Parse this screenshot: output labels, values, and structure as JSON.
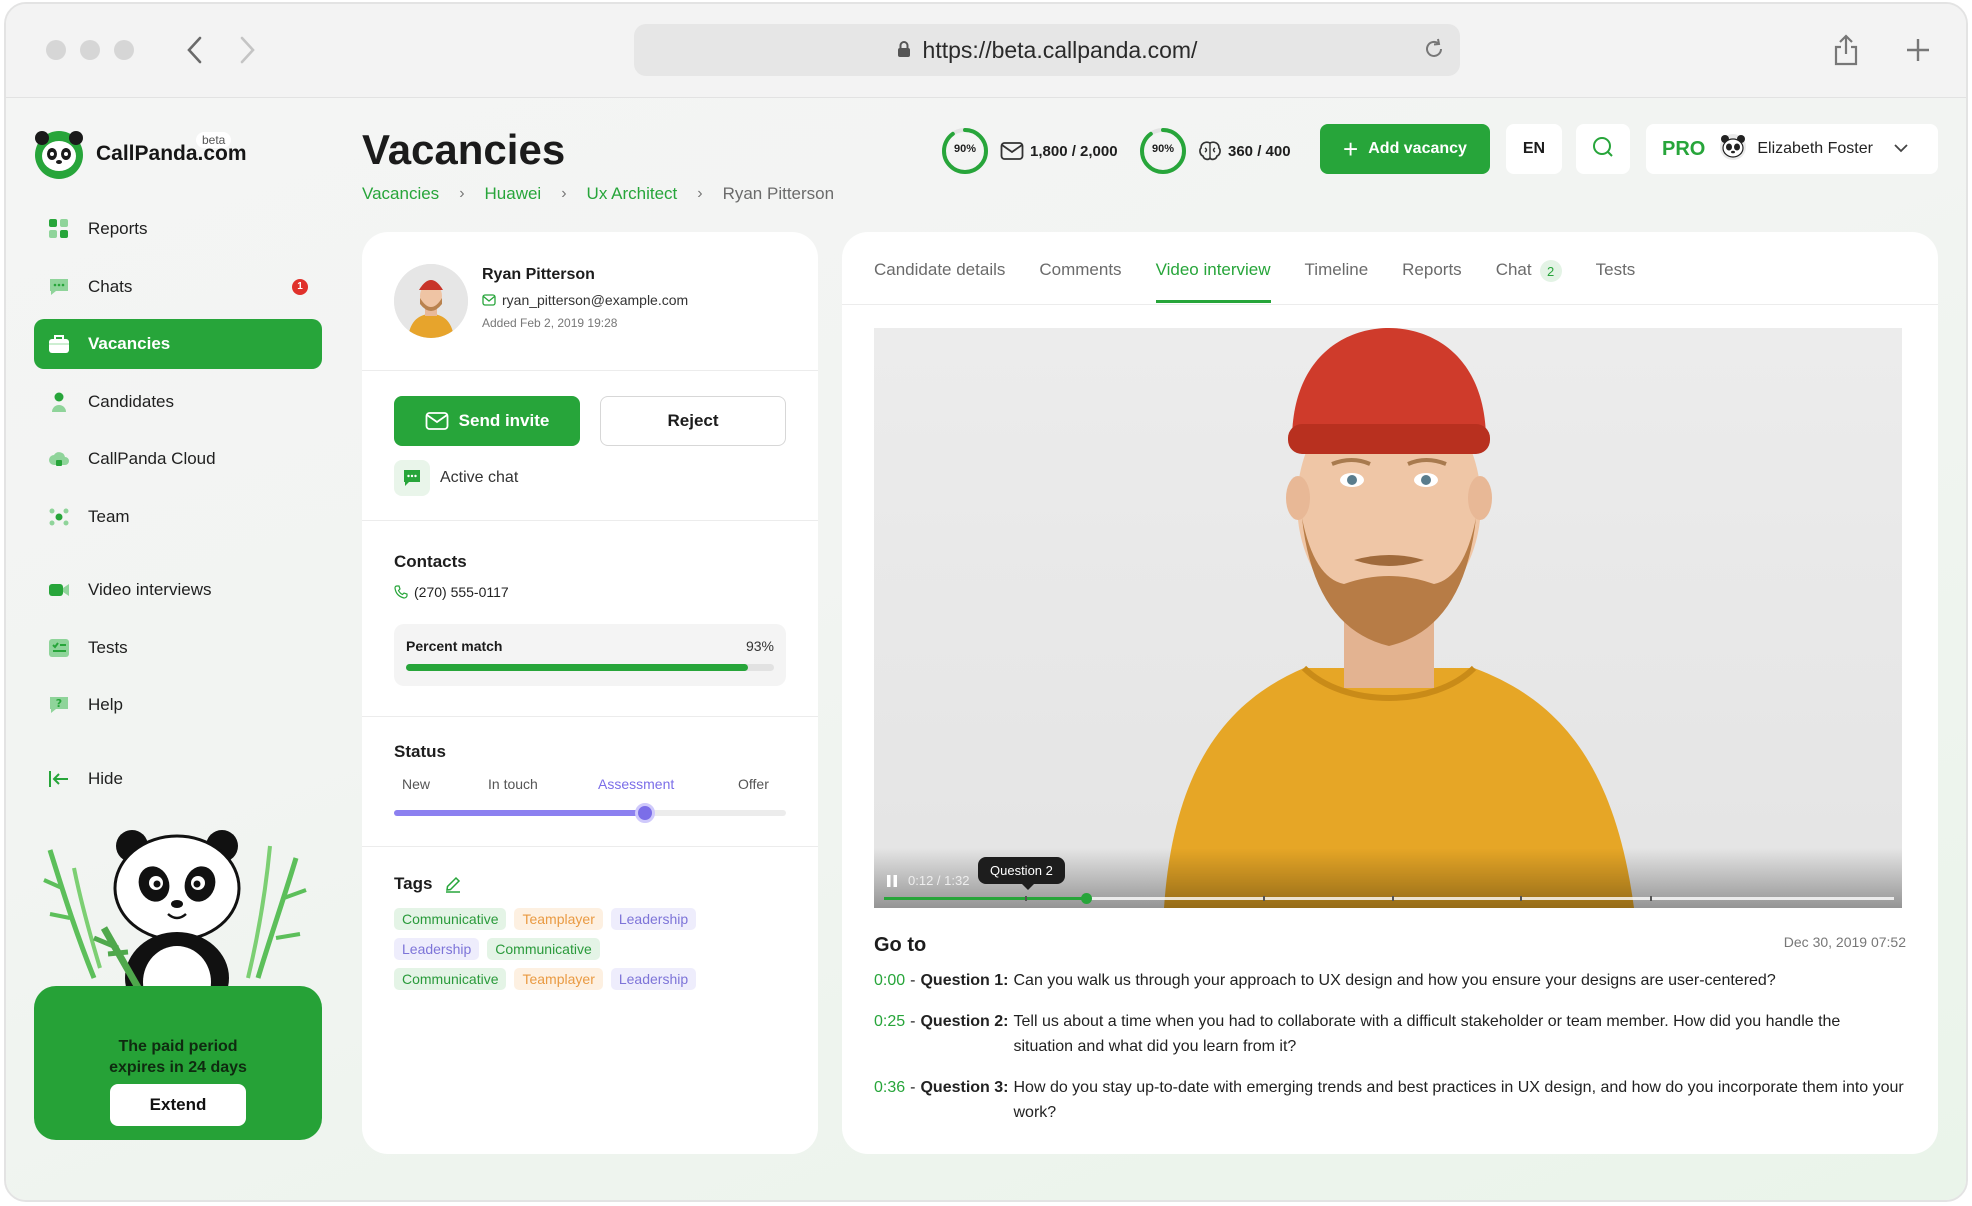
{
  "browser": {
    "url": "https://beta.callpanda.com/"
  },
  "brand": {
    "name": "CallPanda.com",
    "tag": "beta",
    "accent": "#27a53a"
  },
  "sidebar": {
    "items": [
      {
        "label": "Reports",
        "icon": "grid-icon"
      },
      {
        "label": "Chats",
        "icon": "chat-icon",
        "badge": "1"
      },
      {
        "label": "Vacancies",
        "icon": "briefcase-icon",
        "active": true
      },
      {
        "label": "Candidates",
        "icon": "person-icon"
      },
      {
        "label": "CallPanda Cloud",
        "icon": "cloud-icon"
      },
      {
        "label": "Team",
        "icon": "team-icon"
      },
      {
        "label": "Video interviews",
        "icon": "video-icon"
      },
      {
        "label": "Tests",
        "icon": "checklist-icon"
      },
      {
        "label": "Help",
        "icon": "help-icon"
      },
      {
        "label": "Hide",
        "icon": "collapse-icon"
      }
    ],
    "promo": {
      "line1": "The paid period",
      "line2": "expires in 24 days",
      "button": "Extend"
    }
  },
  "header": {
    "title": "Vacancies",
    "breadcrumb": [
      "Vacancies",
      "Huawei",
      "Ux Architect",
      "Ryan Pitterson"
    ],
    "stats": [
      {
        "percent": "90%",
        "value": "1,800 / 2,000",
        "icon": "envelope-icon",
        "fill": 0.9
      },
      {
        "percent": "90%",
        "value": "360 / 400",
        "icon": "brain-icon",
        "fill": 0.9
      }
    ],
    "add_label": "Add vacancy",
    "lang": "EN",
    "plan": "PRO",
    "user": "Elizabeth Foster"
  },
  "candidate": {
    "name": "Ryan Pitterson",
    "email": "ryan_pitterson@example.com",
    "added": "Added Feb 2, 2019 19:28",
    "send_invite": "Send invite",
    "reject": "Reject",
    "active_chat": "Active chat",
    "contacts_title": "Contacts",
    "phone": "(270) 555-0117",
    "match_label": "Percent match",
    "match_value": "93%",
    "match_fill": 0.93,
    "status_title": "Status",
    "statuses": [
      "New",
      "In touch",
      "Assessment",
      "Offer"
    ],
    "status_current": "Assessment",
    "status_progress": 0.64,
    "tags_title": "Tags",
    "tags": [
      [
        {
          "t": "Communicative",
          "c": "g"
        },
        {
          "t": "Teamplayer",
          "c": "o"
        },
        {
          "t": "Leadership",
          "c": "p"
        }
      ],
      [
        {
          "t": "Leadership",
          "c": "p"
        },
        {
          "t": "Communicative",
          "c": "g"
        }
      ],
      [
        {
          "t": "Communicative",
          "c": "g"
        },
        {
          "t": "Teamplayer",
          "c": "o"
        },
        {
          "t": "Leadership",
          "c": "p"
        }
      ]
    ]
  },
  "tabs": [
    {
      "label": "Candidate details"
    },
    {
      "label": "Comments"
    },
    {
      "label": "Video interview",
      "active": true
    },
    {
      "label": "Timeline"
    },
    {
      "label": "Reports"
    },
    {
      "label": "Chat",
      "count": "2"
    },
    {
      "label": "Tests"
    }
  ],
  "video": {
    "time": "0:12 / 1:32",
    "tooltip": "Question 2",
    "played_fraction": 0.2
  },
  "goto": {
    "title": "Go to",
    "date": "Dec 30, 2019 07:52",
    "questions": [
      {
        "time": "0:00",
        "label": "Question 1:",
        "text": "Can you walk us through your approach to UX design and how you ensure your designs are user-centered?"
      },
      {
        "time": "0:25",
        "label": "Question 2:",
        "text": "Tell us about a time when you had to collaborate with a difficult stakeholder or team member. How did you handle the situation and what did you learn from it?"
      },
      {
        "time": "0:36",
        "label": "Question 3:",
        "text": "How do you stay up-to-date with emerging trends and best practices in UX design, and how do you incorporate them into your work?"
      }
    ]
  }
}
